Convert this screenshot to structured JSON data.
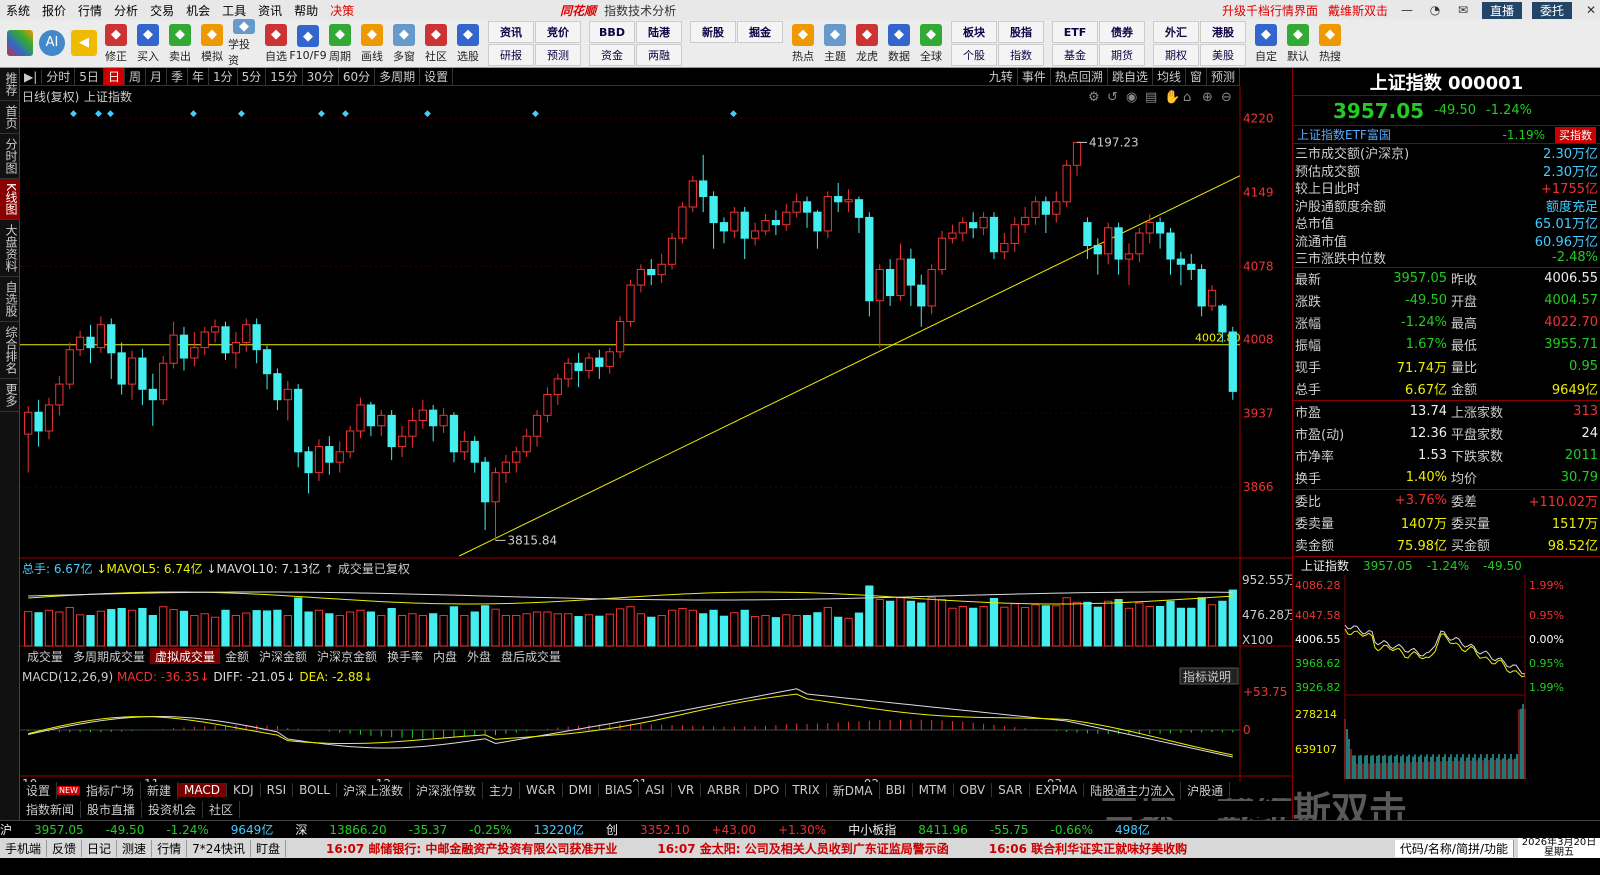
{
  "menu": {
    "items": [
      "系统",
      "报价",
      "行情",
      "分析",
      "交易",
      "机会",
      "工具",
      "资讯",
      "帮助",
      "决策"
    ],
    "brand": "同花顺",
    "window_title": "指数技术分析",
    "right_links": [
      "升级千档行情界面",
      "戴维斯双击"
    ],
    "direct": "直播",
    "user": "委托"
  },
  "toolbar": {
    "buttons": [
      "修正",
      "买入",
      "卖出",
      "模拟",
      "学投资",
      "自选",
      "F10/F9",
      "周期",
      "画线",
      "多窗",
      "社区",
      "选股"
    ],
    "grid1": [
      "资讯",
      "竞价",
      "研报",
      "预测"
    ],
    "grid2": [
      "BBD",
      "陆港",
      "资金",
      "两融"
    ],
    "grid3": [
      "新股",
      "掘金"
    ],
    "buttons2": [
      "热点",
      "主题",
      "龙虎",
      "数据",
      "全球"
    ],
    "grid4": [
      "板块",
      "股指",
      "个股",
      "指数"
    ],
    "grid5": [
      "ETF",
      "债券",
      "基金",
      "期货"
    ],
    "grid6": [
      "外汇",
      "港股",
      "期权",
      "美股"
    ],
    "buttons3": [
      "自定",
      "默认",
      "热搜"
    ]
  },
  "leftrail": [
    "推荐",
    "首页",
    "分时图",
    "K线图",
    "大盘资料",
    "自选股",
    "综合排名",
    "更多"
  ],
  "periodbar": {
    "items": [
      "分时",
      "5日",
      "日",
      "周",
      "月",
      "季",
      "年",
      "1分",
      "5分",
      "15分",
      "30分",
      "60分",
      "多周期",
      "设置"
    ],
    "active": "日",
    "right": [
      "九转",
      "事件",
      "热点回溯",
      "跳自选",
      "均线",
      "窗",
      "预测"
    ]
  },
  "chart_header": {
    "left": "日线(复权)",
    "name": "上证指数"
  },
  "chart_data": {
    "type": "candlestick",
    "title": "上证指数",
    "ylim": [
      3800,
      4230
    ],
    "yticks": [
      4220,
      4149,
      4078,
      4008,
      3937,
      3866
    ],
    "x_month_labels": [
      "10",
      "11",
      "12",
      "01",
      "02",
      "03"
    ],
    "annotations": [
      {
        "label": "4197.23",
        "type": "high"
      },
      {
        "label": "3815.84",
        "type": "low"
      },
      {
        "label": "4002.80",
        "type": "hline",
        "value": 4002.8
      }
    ],
    "trendline": {
      "from": [
        0,
        3800
      ],
      "to": [
        1,
        4165
      ]
    },
    "candles": [
      [
        3917,
        3938,
        3880,
        3944
      ],
      [
        3938,
        3920,
        3905,
        3950
      ],
      [
        3920,
        3945,
        3912,
        3952
      ],
      [
        3945,
        3965,
        3935,
        3973
      ],
      [
        3965,
        3998,
        3960,
        4005
      ],
      [
        3998,
        4010,
        3992,
        4016
      ],
      [
        4010,
        4000,
        3985,
        4022
      ],
      [
        4000,
        4022,
        3995,
        4030
      ],
      [
        4022,
        3995,
        3970,
        4028
      ],
      [
        3995,
        3965,
        3955,
        4005
      ],
      [
        3965,
        3990,
        3950,
        3997
      ],
      [
        3990,
        3960,
        3945,
        3999
      ],
      [
        3960,
        3950,
        3925,
        3975
      ],
      [
        3950,
        3985,
        3945,
        3992
      ],
      [
        3985,
        4012,
        3980,
        4025
      ],
      [
        4012,
        3990,
        3978,
        4020
      ],
      [
        3990,
        4000,
        3982,
        4015
      ],
      [
        4000,
        4015,
        3993,
        4020
      ],
      [
        4015,
        4020,
        4005,
        4027
      ],
      [
        4020,
        3995,
        3988,
        4025
      ],
      [
        3995,
        4005,
        3980,
        4015
      ],
      [
        4005,
        4022,
        3996,
        4028
      ],
      [
        4022,
        3998,
        3985,
        4028
      ],
      [
        3998,
        3975,
        3960,
        4002
      ],
      [
        3975,
        3950,
        3940,
        3980
      ],
      [
        3950,
        3960,
        3930,
        3968
      ],
      [
        3960,
        3900,
        3885,
        3965
      ],
      [
        3900,
        3880,
        3860,
        3905
      ],
      [
        3880,
        3905,
        3872,
        3912
      ],
      [
        3905,
        3890,
        3878,
        3915
      ],
      [
        3890,
        3900,
        3880,
        3910
      ],
      [
        3900,
        3920,
        3894,
        3925
      ],
      [
        3920,
        3945,
        3913,
        3952
      ],
      [
        3945,
        3925,
        3915,
        3948
      ],
      [
        3925,
        3935,
        3915,
        3940
      ],
      [
        3935,
        3905,
        3892,
        3940
      ],
      [
        3905,
        3915,
        3895,
        3925
      ],
      [
        3915,
        3930,
        3904,
        3942
      ],
      [
        3930,
        3940,
        3922,
        3950
      ],
      [
        3940,
        3925,
        3910,
        3945
      ],
      [
        3925,
        3935,
        3918,
        3942
      ],
      [
        3935,
        3900,
        3890,
        3938
      ],
      [
        3900,
        3910,
        3892,
        3920
      ],
      [
        3910,
        3890,
        3880,
        3915
      ],
      [
        3890,
        3852,
        3825,
        3895
      ],
      [
        3852,
        3880,
        3815,
        3885
      ],
      [
        3880,
        3890,
        3870,
        3897
      ],
      [
        3890,
        3900,
        3880,
        3905
      ],
      [
        3900,
        3915,
        3895,
        3922
      ],
      [
        3915,
        3935,
        3905,
        3940
      ],
      [
        3935,
        3955,
        3928,
        3962
      ],
      [
        3955,
        3970,
        3945,
        3975
      ],
      [
        3970,
        3985,
        3962,
        3990
      ],
      [
        3985,
        3978,
        3962,
        3995
      ],
      [
        3978,
        3990,
        3970,
        3995
      ],
      [
        3990,
        3982,
        3970,
        3998
      ],
      [
        3982,
        3996,
        3975,
        4000
      ],
      [
        3996,
        4025,
        3990,
        4030
      ],
      [
        4025,
        4060,
        4020,
        4065
      ],
      [
        4060,
        4075,
        4053,
        4080
      ],
      [
        4075,
        4070,
        4060,
        4085
      ],
      [
        4070,
        4080,
        4062,
        4090
      ],
      [
        4080,
        4105,
        4075,
        4110
      ],
      [
        4105,
        4135,
        4100,
        4140
      ],
      [
        4135,
        4160,
        4130,
        4165
      ],
      [
        4160,
        4145,
        4130,
        4185
      ],
      [
        4145,
        4120,
        4095,
        4150
      ],
      [
        4120,
        4112,
        4100,
        4125
      ],
      [
        4112,
        4130,
        4105,
        4135
      ],
      [
        4130,
        4105,
        4085,
        4135
      ],
      [
        4105,
        4112,
        4098,
        4120
      ],
      [
        4112,
        4122,
        4108,
        4128
      ],
      [
        4122,
        4118,
        4108,
        4132
      ],
      [
        4118,
        4130,
        4112,
        4138
      ],
      [
        4130,
        4140,
        4125,
        4148
      ],
      [
        4140,
        4130,
        4115,
        4145
      ],
      [
        4130,
        4112,
        4095,
        4132
      ],
      [
        4112,
        4145,
        4105,
        4150
      ],
      [
        4145,
        4140,
        4130,
        4158
      ],
      [
        4140,
        4142,
        4130,
        4152
      ],
      [
        4142,
        4125,
        4110,
        4145
      ],
      [
        4125,
        4045,
        4030,
        4130
      ],
      [
        4045,
        4075,
        4000,
        4080
      ],
      [
        4075,
        4050,
        4040,
        4085
      ],
      [
        4050,
        4085,
        4045,
        4100
      ],
      [
        4085,
        4060,
        4040,
        4095
      ],
      [
        4060,
        4040,
        4020,
        4070
      ],
      [
        4040,
        4075,
        4032,
        4080
      ],
      [
        4075,
        4105,
        4070,
        4112
      ],
      [
        4105,
        4110,
        4100,
        4118
      ],
      [
        4110,
        4120,
        4102,
        4125
      ],
      [
        4120,
        4115,
        4105,
        4130
      ],
      [
        4115,
        4125,
        4108,
        4130
      ],
      [
        4125,
        4092,
        4085,
        4130
      ],
      [
        4092,
        4100,
        4085,
        4110
      ],
      [
        4100,
        4118,
        4092,
        4125
      ],
      [
        4118,
        4125,
        4110,
        4135
      ],
      [
        4125,
        4140,
        4118,
        4145
      ],
      [
        4140,
        4128,
        4110,
        4145
      ],
      [
        4128,
        4140,
        4120,
        4150
      ],
      [
        4140,
        4175,
        4135,
        4180
      ],
      [
        4175,
        4197,
        4165,
        4197
      ],
      [
        4120,
        4098,
        4085,
        4125
      ],
      [
        4098,
        4090,
        4070,
        4105
      ],
      [
        4090,
        4115,
        4080,
        4120
      ],
      [
        4115,
        4085,
        4070,
        4120
      ],
      [
        4085,
        4090,
        4060,
        4100
      ],
      [
        4090,
        4110,
        4082,
        4115
      ],
      [
        4110,
        4120,
        4100,
        4128
      ],
      [
        4120,
        4110,
        4095,
        4125
      ],
      [
        4110,
        4085,
        4070,
        4115
      ],
      [
        4085,
        4080,
        4060,
        4092
      ],
      [
        4080,
        4075,
        4065,
        4090
      ],
      [
        4075,
        4040,
        4030,
        4080
      ],
      [
        4040,
        4055,
        4035,
        4060
      ],
      [
        4040,
        4015,
        4005,
        4042
      ],
      [
        4015,
        3958,
        3950,
        4020
      ]
    ],
    "volume": {
      "label": "总手",
      "total": "6.67亿",
      "mavol5": "6.74亿",
      "mavol10": "7.13亿",
      "note": "成交量已复权",
      "yticks": [
        "952.55万",
        "476.28万",
        "X100"
      ]
    },
    "macd": {
      "params": "MACD(12,26,9)",
      "macd": "-36.35",
      "diff": "-21.05",
      "dea": "-2.88",
      "yticks": [
        "53.75",
        "0"
      ]
    }
  },
  "vol_tabs": [
    "成交量",
    "多周期成交量",
    "虚拟成交量",
    "金额",
    "沪深金额",
    "沪深京金额",
    "换手率",
    "内盘",
    "外盘",
    "盘后成交量"
  ],
  "vol_tab_active": "虚拟成交量",
  "indicator_button": "指标说明",
  "ind_tabs": [
    "设置",
    "NEW",
    "指标广场",
    "新建",
    "MACD",
    "KDJ",
    "RSI",
    "BOLL",
    "沪深上涨数",
    "沪深涨停数",
    "主力",
    "W&R",
    "DMI",
    "BIAS",
    "ASI",
    "VR",
    "ARBR",
    "DPO",
    "TRIX",
    "新DMA",
    "BBI",
    "MTM",
    "OBV",
    "SAR",
    "EXPMA",
    "陆股通主力流入",
    "沪股通"
  ],
  "ind_tab_active": "MACD",
  "bottom_tabs": [
    "指数新闻",
    "股市直播",
    "投资机会",
    "社区"
  ],
  "right_panel": {
    "title": "上证指数 000001",
    "price": "3957.05",
    "change": "-49.50",
    "pct": "-1.24%",
    "etf_name": "上证指数ETF富国",
    "etf_pct": "-1.19%",
    "etf_btn": "买指数",
    "stats": [
      {
        "k": "三市成交额(沪深京)",
        "v": "2.30万亿",
        "c": "c"
      },
      {
        "k": "预估成交额",
        "v": "2.30万亿",
        "c": "c"
      },
      {
        "k": "较上日此时",
        "v": "+1755亿",
        "c": "r"
      },
      {
        "k": "沪股通额度余额",
        "v": "额度充足",
        "c": "c"
      },
      {
        "k": "总市值",
        "v": "65.01万亿",
        "c": "c"
      },
      {
        "k": "流通市值",
        "v": "60.96万亿",
        "c": "c"
      },
      {
        "k": "三市涨跌中位数",
        "v": "-2.48%",
        "c": "g"
      }
    ],
    "quote1": [
      {
        "k": "最新",
        "v": "3957.05",
        "vc": "g",
        "k2": "昨收",
        "v2": "4006.55",
        "v2c": "w"
      },
      {
        "k": "涨跌",
        "v": "-49.50",
        "vc": "g",
        "k2": "开盘",
        "v2": "4004.57",
        "v2c": "g"
      },
      {
        "k": "涨幅",
        "v": "-1.24%",
        "vc": "g",
        "k2": "最高",
        "v2": "4022.70",
        "v2c": "r"
      },
      {
        "k": "振幅",
        "v": "1.67%",
        "vc": "g",
        "k2": "最低",
        "v2": "3955.71",
        "v2c": "g"
      },
      {
        "k": "现手",
        "v": "71.74万",
        "vc": "y",
        "k2": "量比",
        "v2": "0.95",
        "v2c": "g"
      },
      {
        "k": "总手",
        "v": "6.67亿",
        "vc": "y",
        "k2": "金额",
        "v2": "9649亿",
        "v2c": "y"
      }
    ],
    "quote2": [
      {
        "k": "市盈",
        "v": "13.74",
        "vc": "w",
        "k2": "上涨家数",
        "v2": "313",
        "v2c": "r"
      },
      {
        "k": "市盈(动)",
        "v": "12.36",
        "vc": "w",
        "k2": "平盘家数",
        "v2": "24",
        "v2c": "w"
      },
      {
        "k": "市净率",
        "v": "1.53",
        "vc": "w",
        "k2": "下跌家数",
        "v2": "2011",
        "v2c": "g"
      },
      {
        "k": "换手",
        "v": "1.40%",
        "vc": "y",
        "k2": "均价",
        "v2": "30.79",
        "v2c": "g"
      }
    ],
    "quote3": [
      {
        "k": "委比",
        "v": "+3.76%",
        "vc": "r",
        "k2": "委差",
        "v2": "+110.02万",
        "v2c": "r"
      },
      {
        "k": "委卖量",
        "v": "1407万",
        "vc": "y",
        "k2": "委买量",
        "v2": "1517万",
        "v2c": "y"
      },
      {
        "k": "卖金额",
        "v": "75.98亿",
        "vc": "y",
        "k2": "买金额",
        "v2": "98.52亿",
        "v2c": "y"
      }
    ],
    "mini": {
      "name": "上证指数",
      "price": "3957.05",
      "pct": "-1.24%",
      "chg": "-49.50",
      "yl": [
        "4086.28",
        "4047.58",
        "4006.55",
        "3968.62",
        "3926.82",
        "278214",
        "639107"
      ],
      "yr": [
        "1.99%",
        "0.95%",
        "0.00%",
        "0.95%",
        "1.99%"
      ]
    }
  },
  "ticker": {
    "sh": {
      "label": "沪",
      "price": "3957.05",
      "chg": "-49.50",
      "pct": "-1.24%",
      "amt": "9649亿"
    },
    "sz": {
      "label": "深",
      "price": "13866.20",
      "chg": "-35.37",
      "pct": "-0.25%",
      "amt": "13220亿"
    },
    "cy": {
      "label": "创",
      "price": "3352.10",
      "chg": "+43.00",
      "pct": "+1.30%"
    },
    "zx": {
      "label": "中小板指",
      "price": "8411.96",
      "chg": "-55.75",
      "pct": "-0.66%",
      "amt": "498亿"
    }
  },
  "status": {
    "items": [
      "手机端",
      "反馈",
      "日记",
      "测速",
      "行情",
      "7*24快讯",
      "盯盘"
    ],
    "news": [
      "16:07 邮储银行: 中邮金融资产投资有限公司获准开业",
      "16:07 金太阳: 公司及相关人员收到广东证监局警示函",
      "16:06 联合利华证实正就味好美收购"
    ],
    "search": "代码/名称/简拼/功能",
    "date": "2026年3月20日",
    "weekday": "星期五"
  },
  "watermark": "雪球 · 戴维斯双击"
}
